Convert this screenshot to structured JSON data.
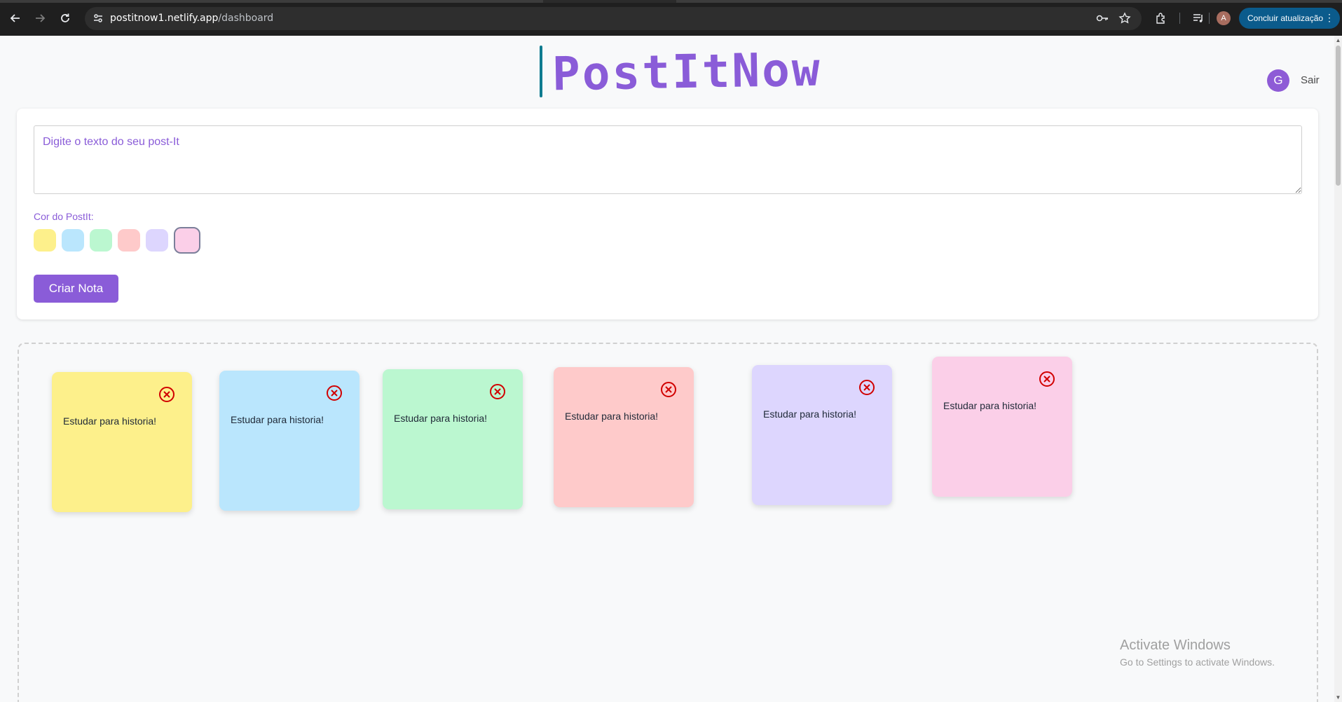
{
  "browser": {
    "url_domain": "postitnow1.netlify.app",
    "url_path": "/dashboard",
    "profile_initial": "A",
    "update_label": "Concluir atualização",
    "update_color": "#0b5b8c"
  },
  "header": {
    "logo_text": "PostItNow",
    "logo_color": "#8a5cd8",
    "user_initial": "G",
    "logout_label": "Sair"
  },
  "create": {
    "placeholder": "Digite o texto do seu post-It",
    "color_label": "Cor do PostIt:",
    "swatches": [
      {
        "color": "#fdf08b",
        "selected": false
      },
      {
        "color": "#bae6fd",
        "selected": false
      },
      {
        "color": "#bbf7d0",
        "selected": false
      },
      {
        "color": "#fecaca",
        "selected": false
      },
      {
        "color": "#ddd6fe",
        "selected": false
      },
      {
        "color": "#fbcfe8",
        "selected": true
      }
    ],
    "button_label": "Criar Nota",
    "accent": "#8a5cd8"
  },
  "notes": [
    {
      "text": "Estudar para historia!",
      "color": "#fdf08b"
    },
    {
      "text": "Estudar para historia!",
      "color": "#bae6fd"
    },
    {
      "text": "Estudar para historia!",
      "color": "#bbf7d0"
    },
    {
      "text": "Estudar para historia!",
      "color": "#fecaca"
    },
    {
      "text": "Estudar para historia!",
      "color": "#ddd6fe"
    },
    {
      "text": "Estudar para historia!",
      "color": "#fbcfe8"
    }
  ],
  "watermark": {
    "title": "Activate Windows",
    "subtitle": "Go to Settings to activate Windows."
  }
}
